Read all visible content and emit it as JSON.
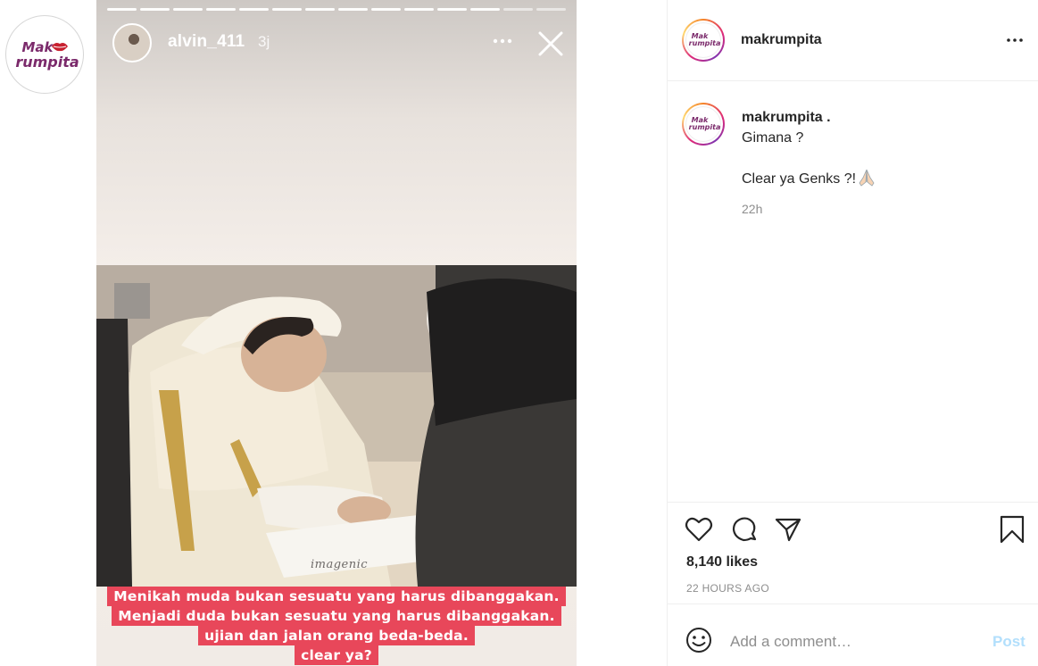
{
  "sidebar": {
    "logo_line1": "Mak",
    "logo_line2": "rumpita"
  },
  "story": {
    "segments_total": 14,
    "segments_done": 12,
    "username": "alvin_411",
    "time": "3j",
    "watermark": "imagenic",
    "caption_lines": [
      "Menikah muda bukan sesuatu yang harus dibanggakan.",
      "Menjadi duda bukan sesuatu yang harus dibanggakan.",
      "ujian dan jalan orang beda-beda.",
      "clear ya?"
    ]
  },
  "post": {
    "author": "makrumpita",
    "more_icon": "more-horizontal-icon",
    "caption": {
      "username": "makrumpita .",
      "line1": "Gimana ?",
      "line2": "Clear ya Genks ?!",
      "emoji": "folded-hands-icon",
      "time": "22h"
    },
    "likes": "8,140 likes",
    "posted_ago": "22 HOURS AGO",
    "comment_placeholder": "Add a comment…",
    "post_label": "Post"
  },
  "colors": {
    "caption_bg": "#e8475a",
    "brand_purple": "#7b2a6b",
    "post_button": "#b2dffc"
  }
}
